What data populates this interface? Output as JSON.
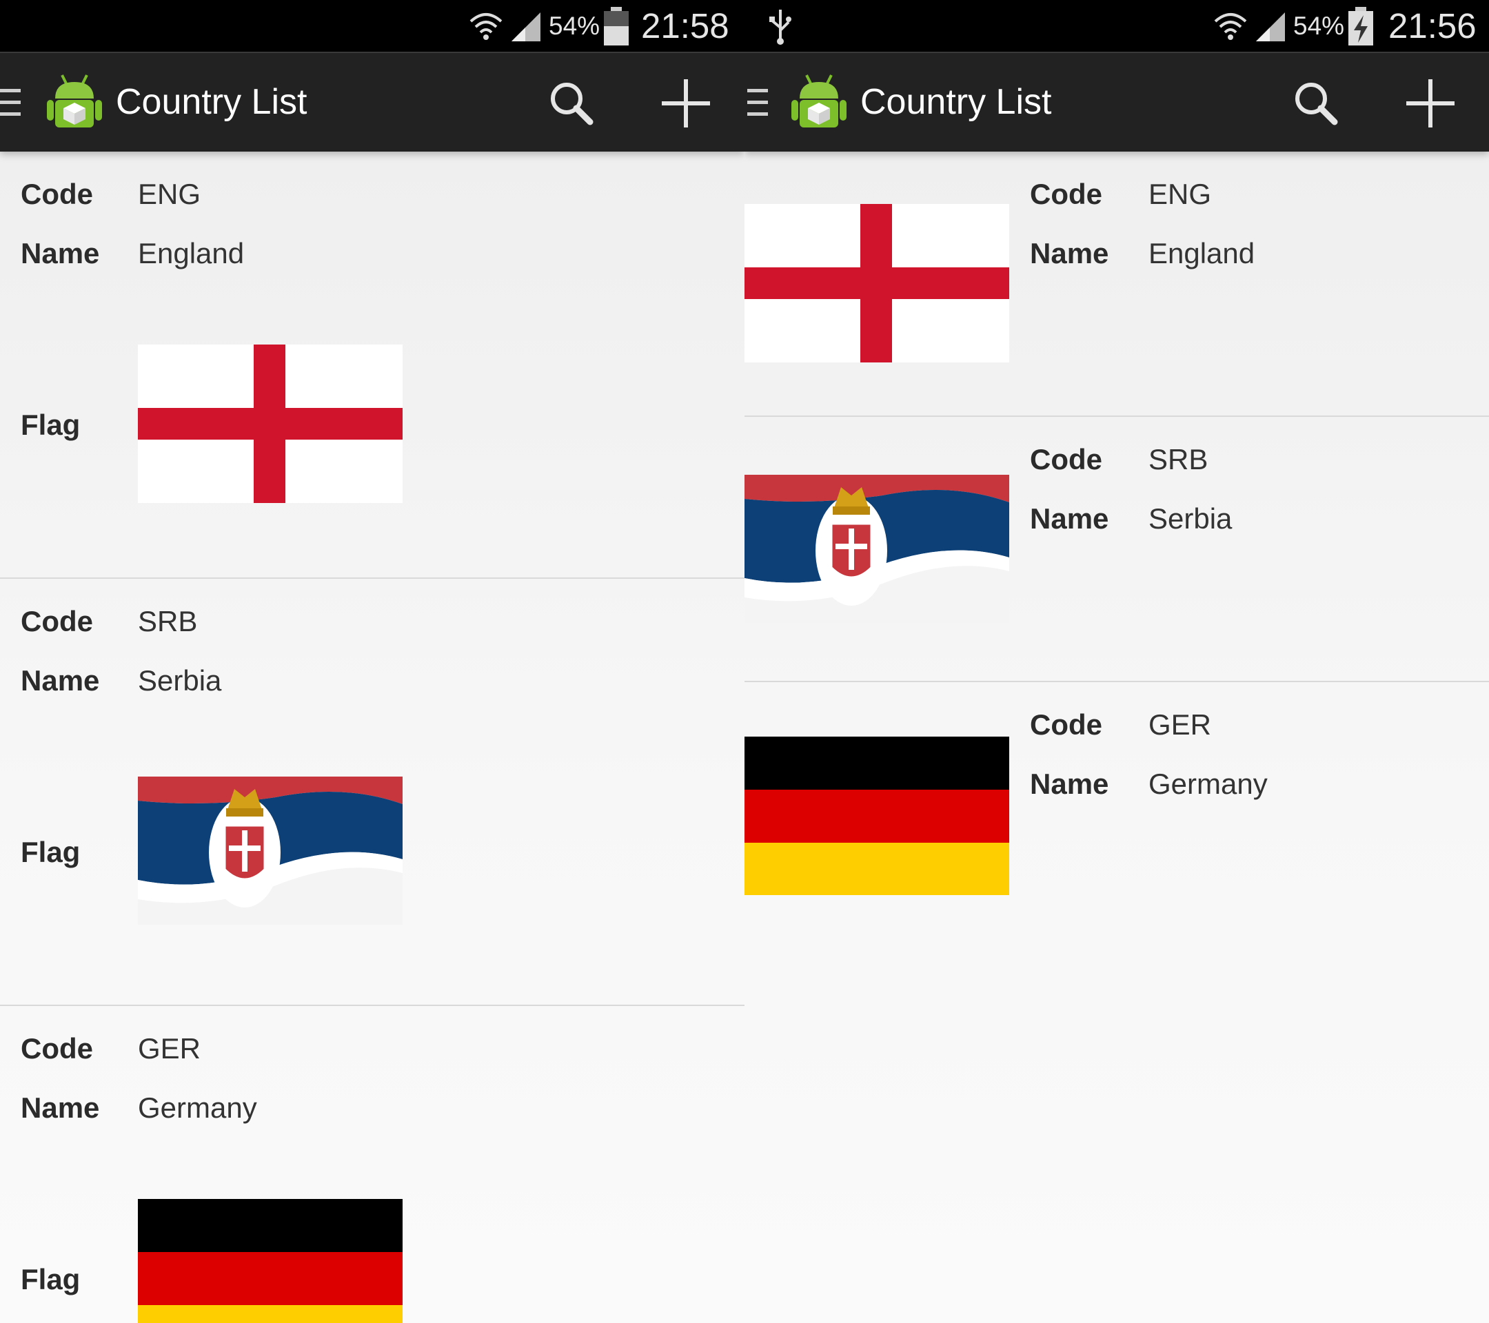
{
  "screens": [
    {
      "status": {
        "battery_pct": "54%",
        "time": "21:58"
      },
      "actionbar": {
        "title": "Country List"
      },
      "labels": {
        "code": "Code",
        "name": "Name",
        "flag": "Flag"
      },
      "countries": [
        {
          "code": "ENG",
          "name": "England",
          "flag_icon": "england-flag"
        },
        {
          "code": "SRB",
          "name": "Serbia",
          "flag_icon": "serbia-flag"
        },
        {
          "code": "GER",
          "name": "Germany",
          "flag_icon": "germany-flag"
        }
      ]
    },
    {
      "status": {
        "battery_pct": "54%",
        "time": "21:56"
      },
      "actionbar": {
        "title": "Country List"
      },
      "labels": {
        "code": "Code",
        "name": "Name"
      },
      "countries": [
        {
          "code": "ENG",
          "name": "England",
          "flag_icon": "england-flag"
        },
        {
          "code": "SRB",
          "name": "Serbia",
          "flag_icon": "serbia-flag"
        },
        {
          "code": "GER",
          "name": "Germany",
          "flag_icon": "germany-flag"
        }
      ]
    }
  ],
  "colors": {
    "england_red": "#cf142b",
    "serbia_red": "#c6363c",
    "serbia_blue": "#0c4076",
    "germany_black": "#000000",
    "germany_red": "#dd0000",
    "germany_gold": "#ffce00",
    "actionbar_bg": "#222222"
  }
}
